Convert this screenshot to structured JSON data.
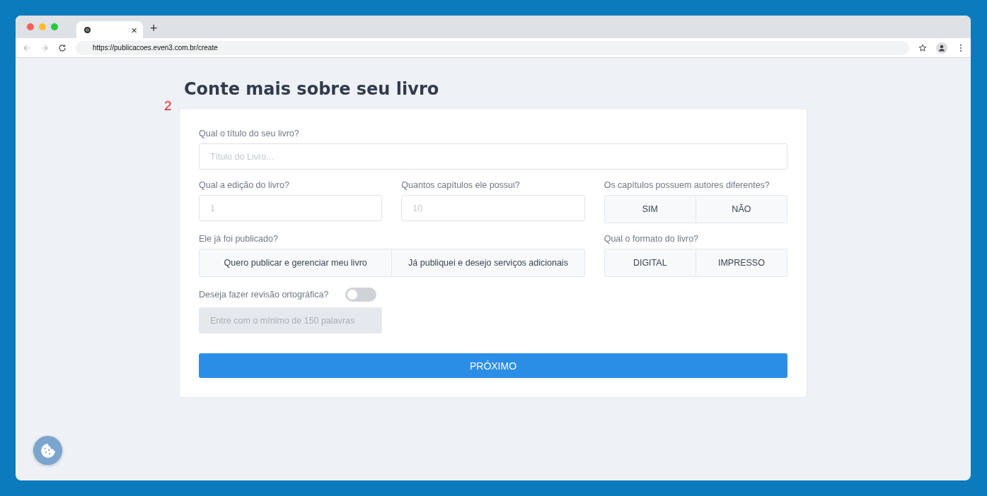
{
  "browser": {
    "tab_close": "×",
    "new_tab": "+",
    "url": "https://publicacoes.even3.com.br/create"
  },
  "page": {
    "heading": "Conte mais sobre seu livro",
    "step": "2",
    "title_field": {
      "label": "Qual o título do seu livro?",
      "placeholder": "Título do Livro..."
    },
    "edition_field": {
      "label": "Qual a edição do livro?",
      "placeholder": "1"
    },
    "chapters_field": {
      "label": "Quantos capítulos ele possui?",
      "placeholder": "10"
    },
    "authors": {
      "label": "Os capítulos possuem autores diferentes?",
      "options": [
        {
          "label": "SIM",
          "selected": false
        },
        {
          "label": "NÃO",
          "selected": false
        }
      ]
    },
    "published": {
      "label": "Ele já foi publicado?",
      "options": [
        {
          "label": "Quero publicar e gerenciar meu livro",
          "selected": false
        },
        {
          "label": "Já publiquei e desejo serviços adicionais",
          "selected": false
        }
      ]
    },
    "format": {
      "label": "Qual o formato do livro?",
      "options": [
        {
          "label": "DIGITAL",
          "selected": false
        },
        {
          "label": "IMPRESSO",
          "selected": false
        }
      ]
    },
    "revision": {
      "label": "Deseja fazer revisão ortográfica?",
      "on": false,
      "placeholder": "Entre com o mínimo de 150 palavras",
      "disabled": true
    },
    "next_button": "PRÓXIMO"
  }
}
